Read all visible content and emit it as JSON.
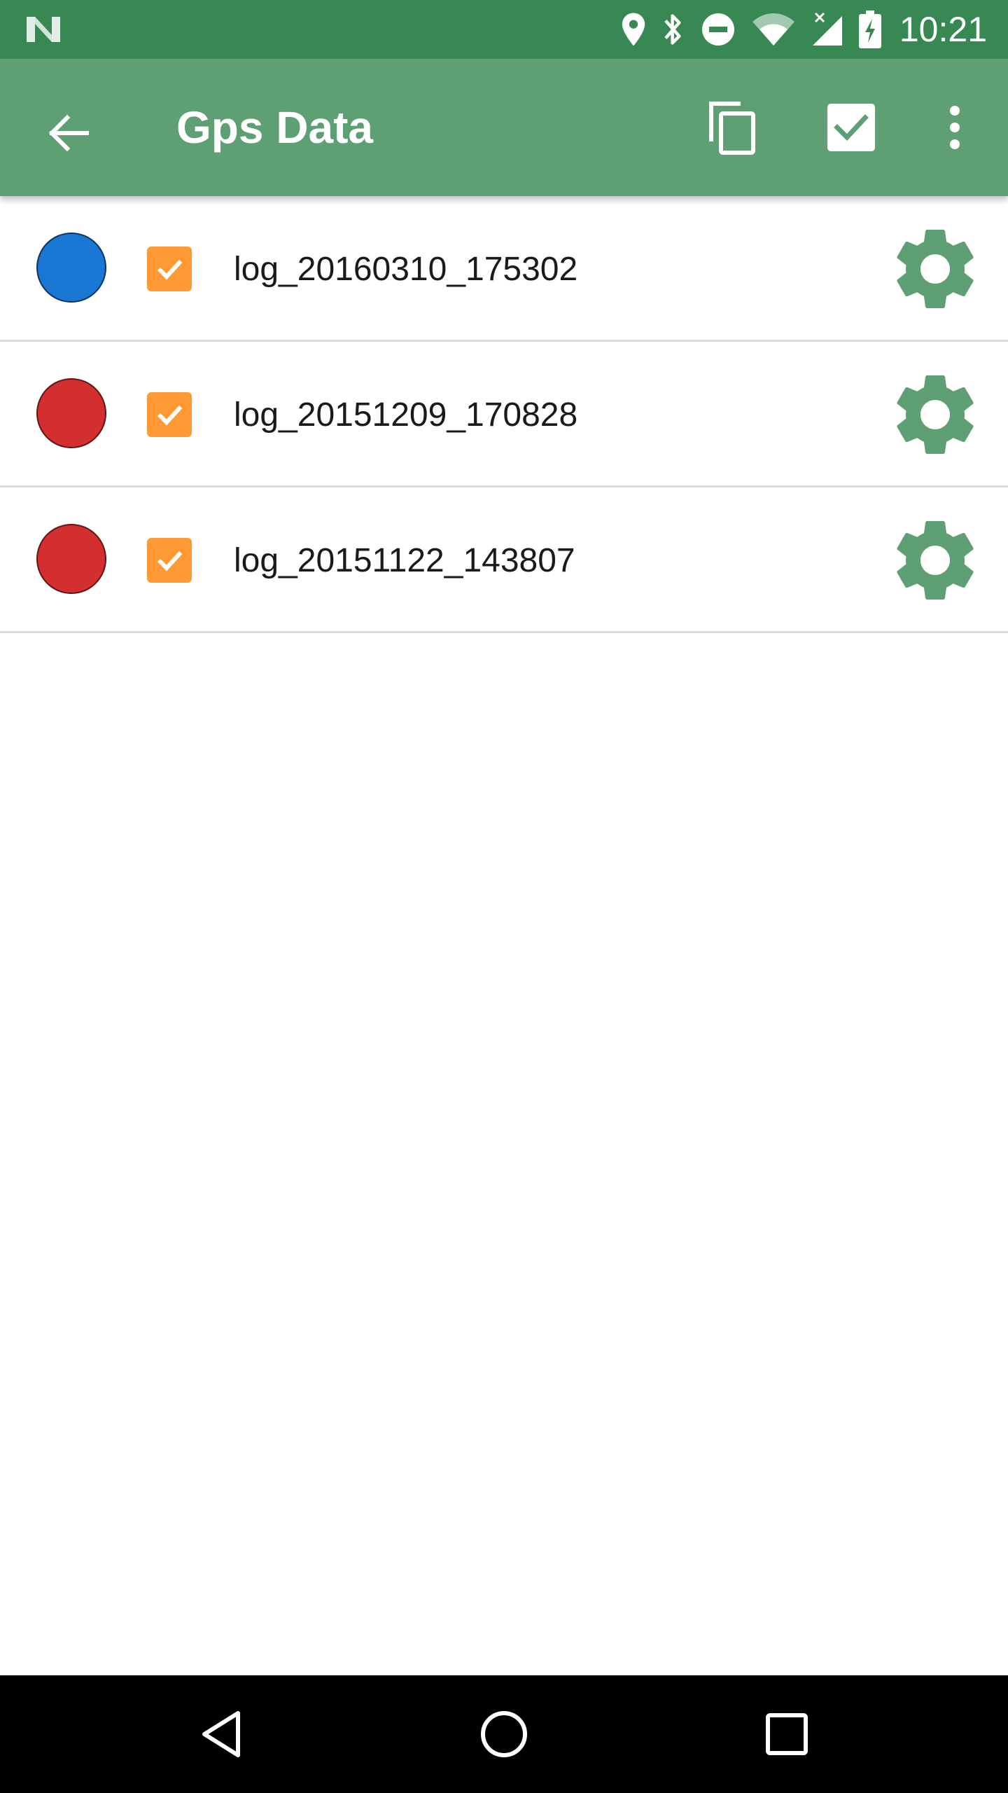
{
  "status_bar": {
    "time": "10:21",
    "icons": [
      "n-logo-icon",
      "location-icon",
      "bluetooth-icon",
      "do-not-disturb-icon",
      "wifi-icon",
      "cell-signal-icon",
      "battery-charging-icon"
    ]
  },
  "app_bar": {
    "title": "Gps Data",
    "actions": [
      "back-arrow-icon",
      "copy-icon",
      "check-box-icon",
      "more-vert-icon"
    ]
  },
  "list": {
    "items": [
      {
        "label": "log_20160310_175302",
        "color": "#1976d2",
        "checked": true
      },
      {
        "label": "log_20151209_170828",
        "color": "#d32f2f",
        "checked": true
      },
      {
        "label": "log_20151122_143807",
        "color": "#d32f2f",
        "checked": true
      }
    ]
  },
  "colors": {
    "status_bar": "#378852",
    "app_bar": "#5f9f74",
    "checkbox": "#ff9933",
    "gear": "#5f9f74"
  },
  "nav_bar": {
    "buttons": [
      "back-triangle-icon",
      "home-circle-icon",
      "recents-square-icon"
    ]
  }
}
